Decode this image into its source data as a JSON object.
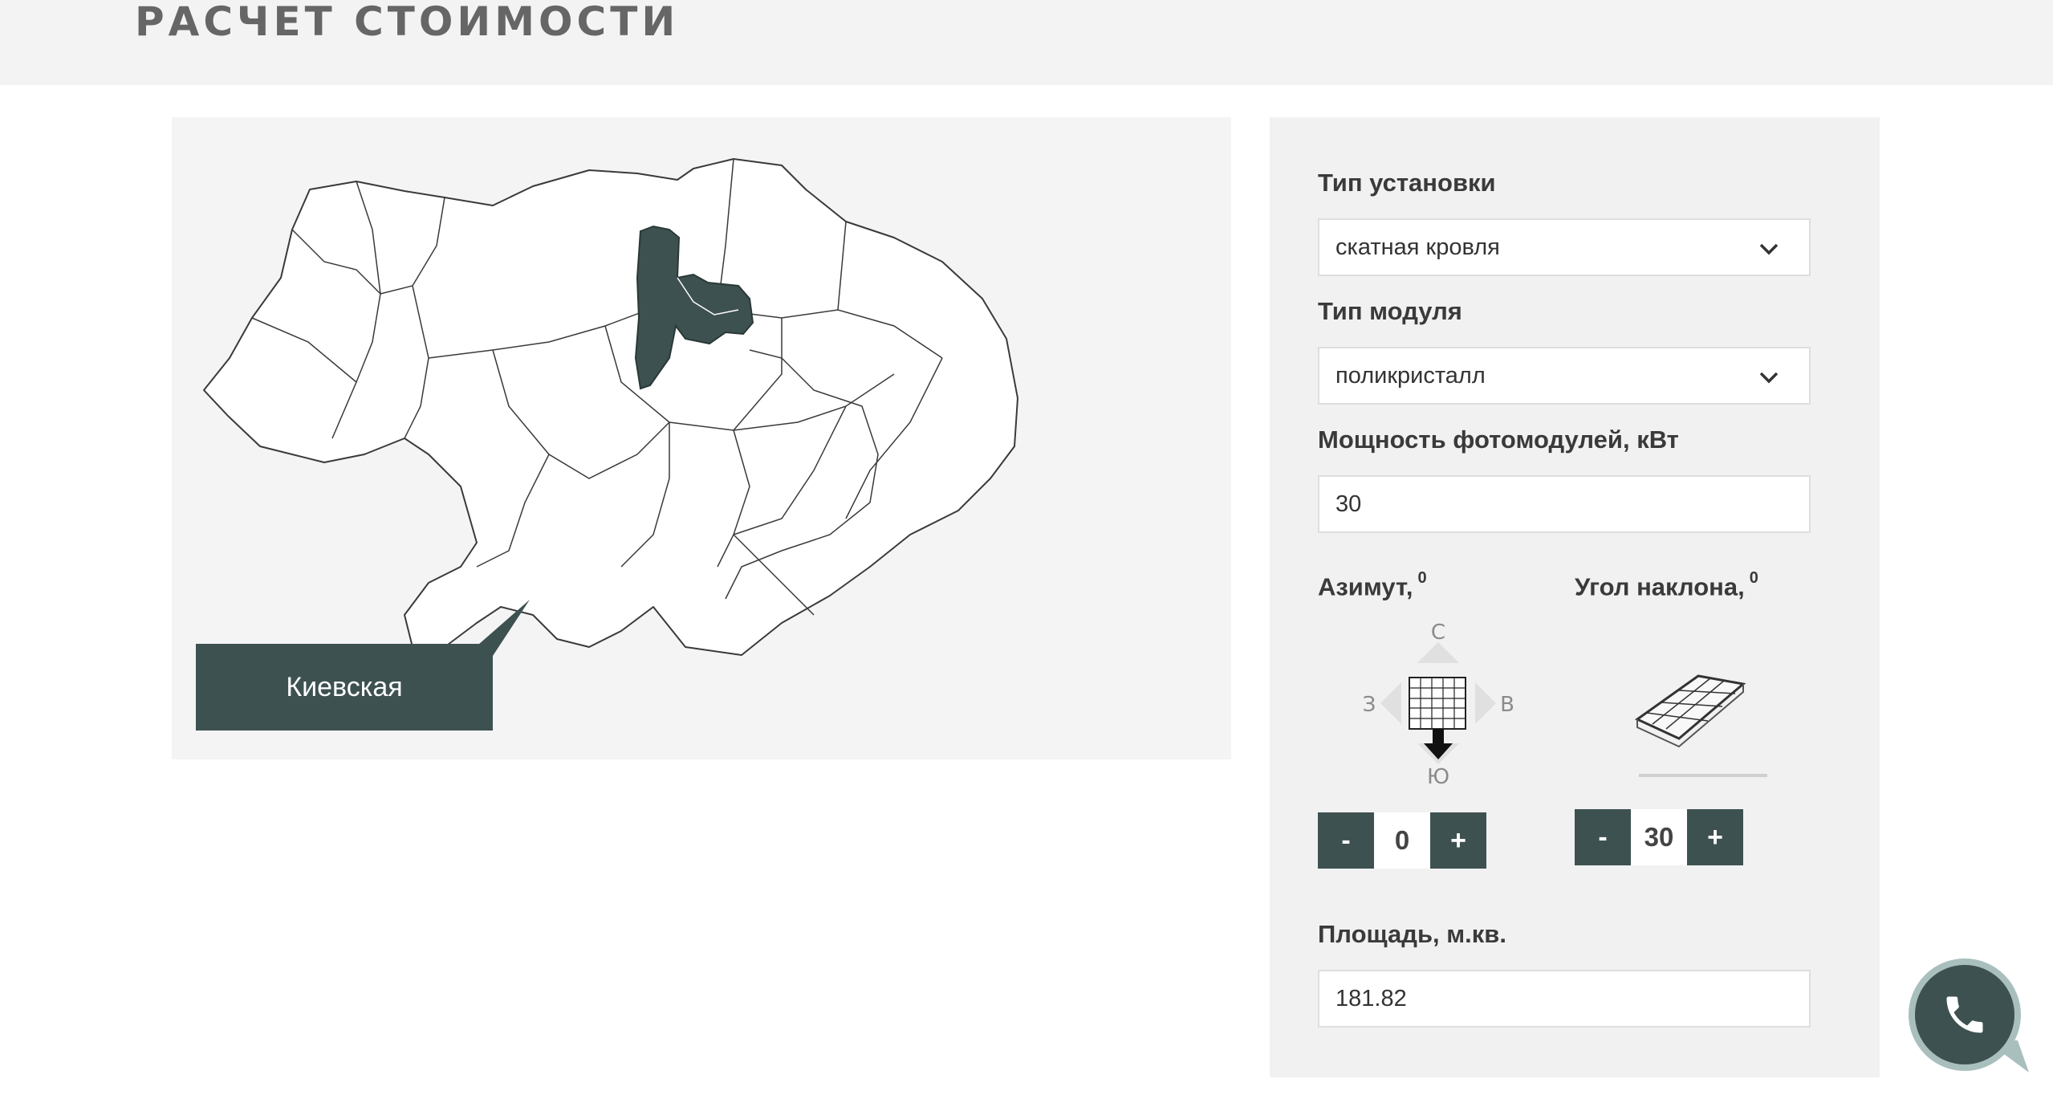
{
  "page": {
    "title": "РАСЧЕТ СТОИМОСТИ"
  },
  "map": {
    "selected_region": "Киевская",
    "colors": {
      "selected": "#3d5150",
      "region_fill": "#ffffff",
      "region_border": "#3a3a3a",
      "background": "#f4f4f4"
    }
  },
  "form": {
    "install_type": {
      "label": "Тип установки",
      "value": "скатная кровля"
    },
    "module_type": {
      "label": "Тип модуля",
      "value": "поликристалл"
    },
    "power": {
      "label": "Мощность фотомодулей, кВт",
      "value": "30"
    },
    "azimuth": {
      "label": "Азимут,",
      "unit": "0",
      "compass": {
        "north": "С",
        "west": "З",
        "east": "В",
        "south": "Ю"
      },
      "minus": "-",
      "value": "0",
      "plus": "+"
    },
    "tilt": {
      "label": "Угол наклона,",
      "unit": "0",
      "minus": "-",
      "value": "30",
      "plus": "+"
    },
    "area": {
      "label": "Площадь, м.кв.",
      "value": "181.82"
    }
  },
  "icons": {
    "dropdown": "chevron-down-icon",
    "call": "phone-icon"
  },
  "colors": {
    "accent": "#3d5150",
    "accent_ring": "#a9bfbe",
    "panel_bg": "#f1f1f1",
    "topbar_bg": "#f3f3f3"
  }
}
